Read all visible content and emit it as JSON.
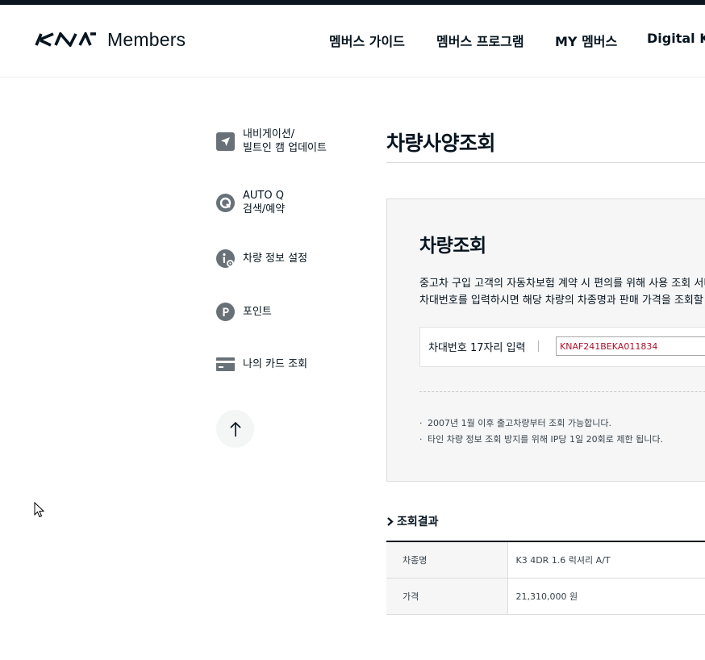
{
  "brand": {
    "name": "Members"
  },
  "nav": {
    "items": [
      {
        "label": "멤버스 가이드"
      },
      {
        "label": "멤버스 프로그램"
      },
      {
        "label": "MY 멤버스"
      },
      {
        "label": "Digital Kia"
      }
    ]
  },
  "sidebar": {
    "items": [
      {
        "label": "내비게이션/\n빌트인 캠 업데이트",
        "icon": "navigation-arrow-icon"
      },
      {
        "label": "AUTO Q\n검색/예약",
        "icon": "auto-q-icon"
      },
      {
        "label": "차량 정보 설정",
        "icon": "info-gear-icon"
      },
      {
        "label": "포인트",
        "icon": "point-icon"
      },
      {
        "label": "나의 카드 조회",
        "icon": "card-icon"
      }
    ],
    "top_button_icon": "arrow-up-icon"
  },
  "page": {
    "title": "차량사양조회"
  },
  "search": {
    "title": "차량조회",
    "desc_line1": "중고차 구입 고객의 자동차보험 계약 시 편의를 위해 사용 조회 서비스를 제공합니다.",
    "desc_line2": "차대번호를 입력하시면 해당 차량의 차종명과 판매 가격을 조회할 수 있습니다.",
    "vin_label": "차대번호 17자리 입력",
    "vin_value": "KNAF241BEKA011834",
    "notes": [
      "2007년 1월 이후 출고차량부터 조회 가능합니다.",
      "타인 차량 정보 조회 방지를 위해 IP당 1일 20회로 제한 됩니다."
    ]
  },
  "result": {
    "title": "조회결과",
    "rows": [
      {
        "label": "차종명",
        "value": "K3 4DR 1.6 럭셔리 A/T"
      },
      {
        "label": "가격",
        "value": "21,310,000 원"
      }
    ]
  },
  "colors": {
    "primary": "#05141f",
    "panel_bg": "#f6f6f6",
    "input_text": "#b0112b",
    "icon_gray": "#697178"
  }
}
